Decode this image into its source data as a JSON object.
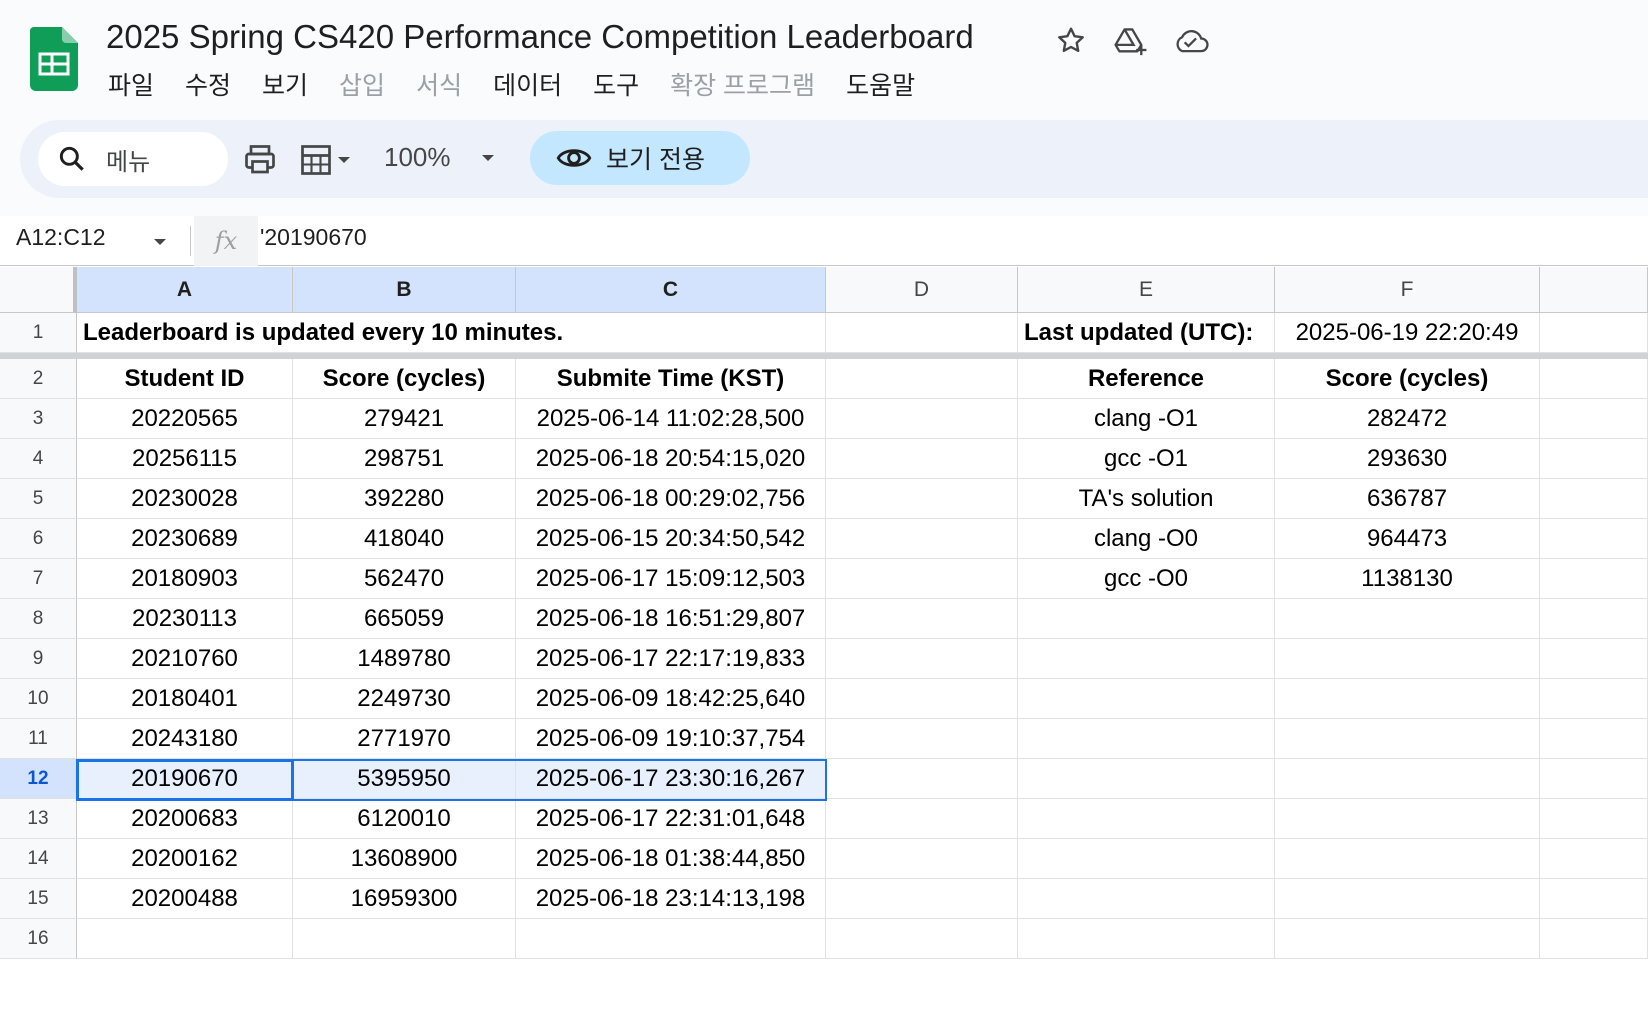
{
  "app": {
    "doc_title": "2025 Spring CS420 Performance Competition Leaderboard",
    "icons": [
      "star-icon",
      "move-to-drive-icon",
      "cloud-saved-icon"
    ]
  },
  "menu": {
    "items": [
      {
        "label": "파일",
        "disabled": false
      },
      {
        "label": "수정",
        "disabled": false
      },
      {
        "label": "보기",
        "disabled": false
      },
      {
        "label": "삽입",
        "disabled": true
      },
      {
        "label": "서식",
        "disabled": true
      },
      {
        "label": "데이터",
        "disabled": false
      },
      {
        "label": "도구",
        "disabled": false
      },
      {
        "label": "확장 프로그램",
        "disabled": true
      },
      {
        "label": "도움말",
        "disabled": false
      }
    ]
  },
  "toolbar": {
    "search_label": "메뉴",
    "zoom": "100%",
    "view_only_label": "보기 전용"
  },
  "formula_bar": {
    "name_box": "A12:C12",
    "fx": "fx",
    "value": "'20190670"
  },
  "grid": {
    "columns": [
      "A",
      "B",
      "C",
      "D",
      "E",
      "F"
    ],
    "selected_columns": [
      "A",
      "B",
      "C"
    ],
    "selected_row": 12,
    "row_numbers": [
      "1",
      "2",
      "3",
      "4",
      "5",
      "6",
      "7",
      "8",
      "9",
      "10",
      "11",
      "12",
      "13",
      "14",
      "15",
      "16"
    ],
    "notice": "Leaderboard is updated every 10 minutes.",
    "last_updated_label": "Last updated (UTC):",
    "last_updated_value": "2025-06-19 22:20:49",
    "leaderboard_headers": [
      "Student ID",
      "Score (cycles)",
      "Submite Time (KST)"
    ],
    "leaderboard_rows": [
      [
        "20220565",
        "279421",
        "2025-06-14 11:02:28,500"
      ],
      [
        "20256115",
        "298751",
        "2025-06-18 20:54:15,020"
      ],
      [
        "20230028",
        "392280",
        "2025-06-18 00:29:02,756"
      ],
      [
        "20230689",
        "418040",
        "2025-06-15 20:34:50,542"
      ],
      [
        "20180903",
        "562470",
        "2025-06-17 15:09:12,503"
      ],
      [
        "20230113",
        "665059",
        "2025-06-18 16:51:29,807"
      ],
      [
        "20210760",
        "1489780",
        "2025-06-17 22:17:19,833"
      ],
      [
        "20180401",
        "2249730",
        "2025-06-09 18:42:25,640"
      ],
      [
        "20243180",
        "2771970",
        "2025-06-09 19:10:37,754"
      ],
      [
        "20190670",
        "5395950",
        "2025-06-17 23:30:16,267"
      ],
      [
        "20200683",
        "6120010",
        "2025-06-17 22:31:01,648"
      ],
      [
        "20200162",
        "13608900",
        "2025-06-18 01:38:44,850"
      ],
      [
        "20200488",
        "16959300",
        "2025-06-18 23:14:13,198"
      ]
    ],
    "reference_headers": [
      "Reference",
      "Score (cycles)"
    ],
    "reference_rows": [
      [
        "clang -O1",
        "282472"
      ],
      [
        "gcc -O1",
        "293630"
      ],
      [
        "TA's solution",
        "636787"
      ],
      [
        "clang -O0",
        "964473"
      ],
      [
        "gcc -O0",
        "1138130"
      ]
    ]
  }
}
